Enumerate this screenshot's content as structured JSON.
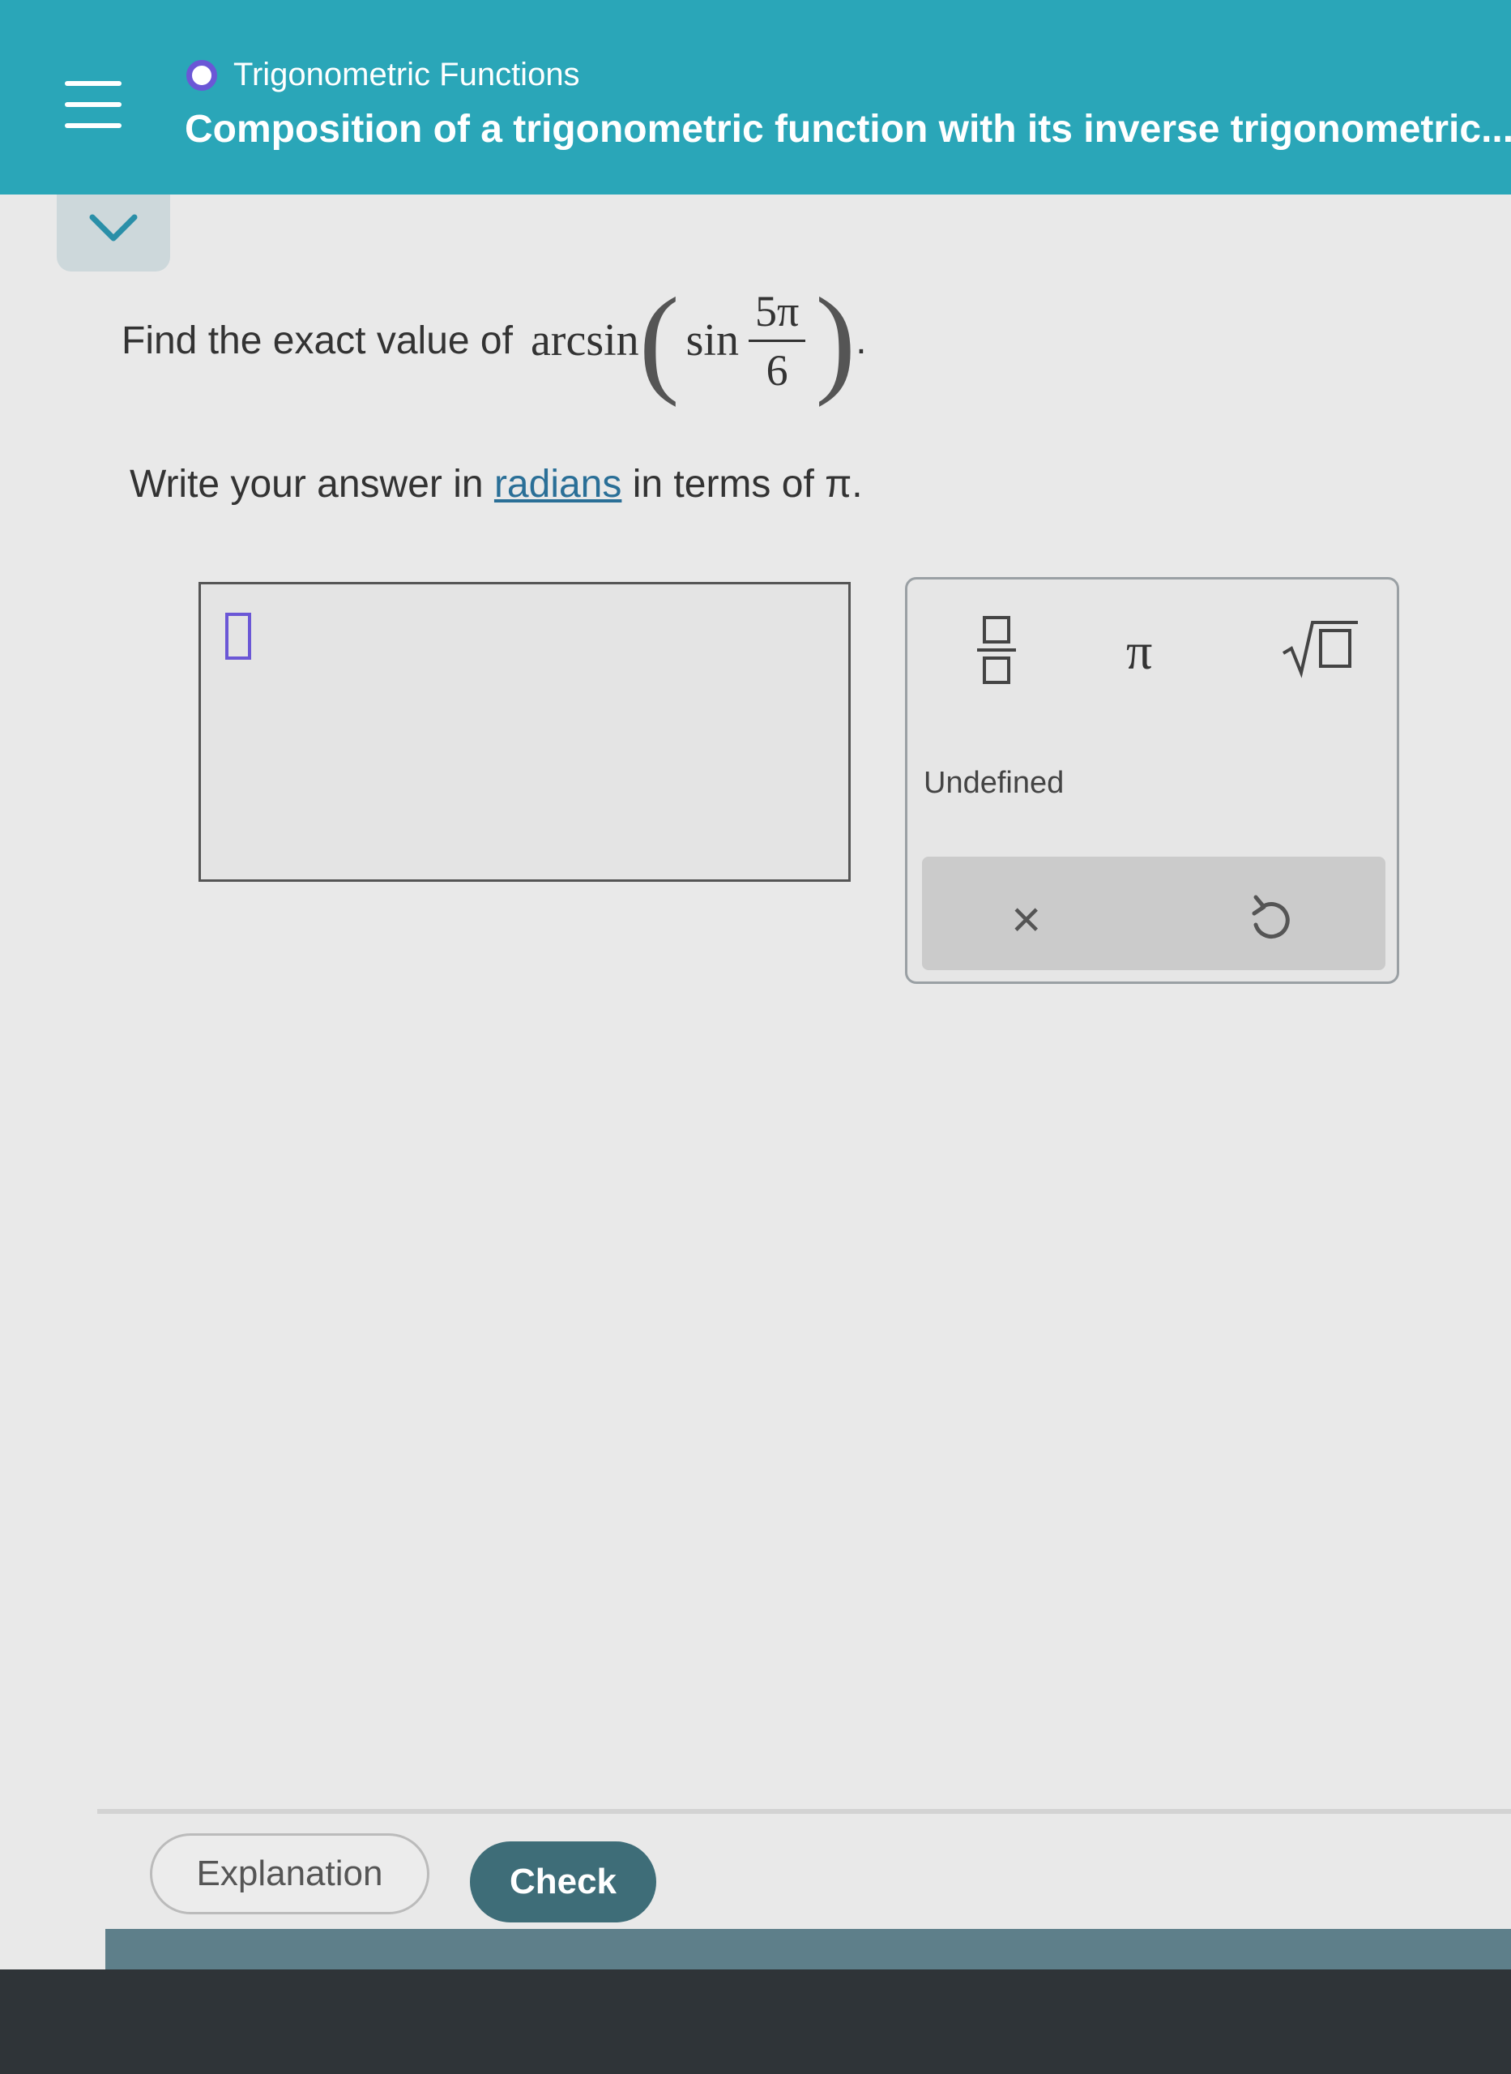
{
  "header": {
    "topic": "Trigonometric Functions",
    "subtitle": "Composition of a trigonometric function with its inverse trigonometric..."
  },
  "question": {
    "prefix": "Find the exact value of",
    "outer_fn": "arcsin",
    "inner_fn": "sin",
    "numerator": "5π",
    "denominator": "6",
    "suffix": ".",
    "instruction_before": "Write your answer in",
    "instruction_link": "radians",
    "instruction_after": "in terms of π."
  },
  "keypad": {
    "pi_label": "π",
    "undefined_label": "Undefined",
    "clear_label": "×"
  },
  "footer": {
    "explanation_label": "Explanation",
    "check_label": "Check"
  },
  "colors": {
    "header_bg": "#2aa6b8",
    "accent_purple": "#6b57d6",
    "check_bg": "#3e6d78"
  }
}
